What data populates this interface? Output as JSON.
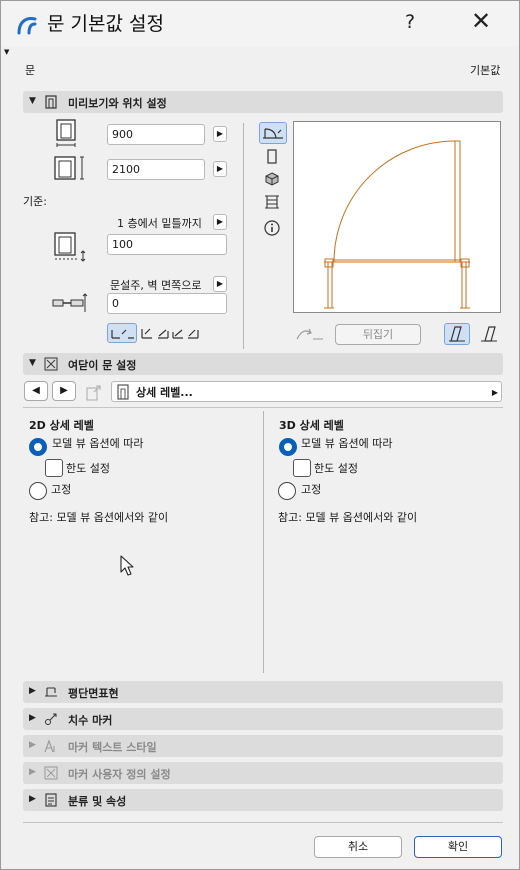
{
  "window": {
    "title": "문 기본값 설정",
    "help_label": "?",
    "close_label": "✕"
  },
  "top": {
    "left_label": "문",
    "right_label": "기본값"
  },
  "preview_section": {
    "header": "미리보기와 위치 설정",
    "width_value": "900",
    "height_value": "2100",
    "anchor_label": "기준:",
    "story_label": "1 층에서 밑틀까지",
    "story_value": "100",
    "reveal_label": "문설주, 벽 면쪽으로",
    "reveal_value": "0",
    "flip_label": "뒤집기"
  },
  "opening_section": {
    "header": "여닫이 문 설정",
    "nav_dropdown": "상세 레벨..."
  },
  "detail2d": {
    "title": "2D 상세 레벨",
    "opt_model": "모델 뷰 옵션에 따라",
    "opt_limit": "한도 설정",
    "opt_fixed": "고정",
    "note": "참고: 모델 뷰 옵션에서와 같이"
  },
  "detail3d": {
    "title": "3D 상세 레벨",
    "opt_model": "모델 뷰 옵션에 따라",
    "opt_limit": "한도 설정",
    "opt_fixed": "고정",
    "note": "참고: 모델 뷰 옵션에서와 같이"
  },
  "collapsed_sections": {
    "plan": "평단면표현",
    "dimension": "치수 마커",
    "marker_text": "마커 텍스트 스타일",
    "marker_custom": "마커 사용자 정의 설정",
    "classification": "분류 및 속성"
  },
  "footer": {
    "cancel": "취소",
    "ok": "확인"
  },
  "colors": {
    "accent": "#0a5fb8",
    "door_stroke": "#c8701e",
    "header_bg": "#dcdcdc"
  }
}
